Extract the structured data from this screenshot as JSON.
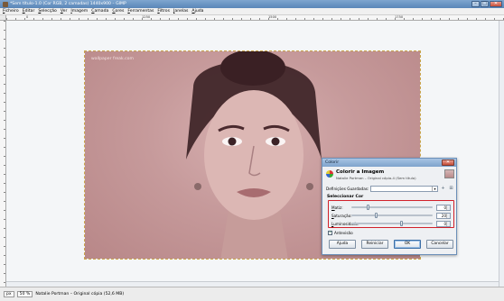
{
  "window": {
    "title": "*Sem título-1.0 (Cor RGB, 2 camadas) 1440x900 – GIMP",
    "buttons": {
      "minimize": "–",
      "maximize": "□",
      "close": "✕"
    }
  },
  "menubar": [
    "Ficheiro",
    "Editar",
    "Selecção",
    "Ver",
    "Imagem",
    "Camada",
    "Cores",
    "Ferramentas",
    "Filtros",
    "Janelas",
    "Ajuda"
  ],
  "ruler": {
    "ticks": [
      "0",
      "1250",
      "1500",
      "1750"
    ]
  },
  "canvas": {
    "watermark": "wallpaper freak.com",
    "photo_tint": "#c69a9b"
  },
  "statusbar": {
    "unit": "px",
    "zoom": "50 %",
    "message": "Natalie Portman – Original cópia (52,6 MB)"
  },
  "dialog": {
    "title": "Colorir",
    "header_title": "Colorir a Imagem",
    "header_subtitle": "Natalie Portman – Original cópia-4 (Sem título)",
    "presets_label": "Definições Guardadas:",
    "presets_value": "",
    "add_icon": "+",
    "menu_icon": "⊞",
    "group_label": "Seleccionar Cor",
    "sliders": [
      {
        "label": "Matiz:",
        "value": "0",
        "fraction": 0.2
      },
      {
        "label": "Saturação:",
        "value": "20",
        "fraction": 0.3
      },
      {
        "label": "Luminosidade:",
        "value": "0",
        "fraction": 0.62
      }
    ],
    "preview_label": "Antevisão",
    "preview_checked": "✓",
    "buttons": {
      "help": "Ajuda",
      "reset": "Reiniciar",
      "ok": "OK",
      "cancel": "Cancelar"
    },
    "accent_color": "#d1202a"
  }
}
